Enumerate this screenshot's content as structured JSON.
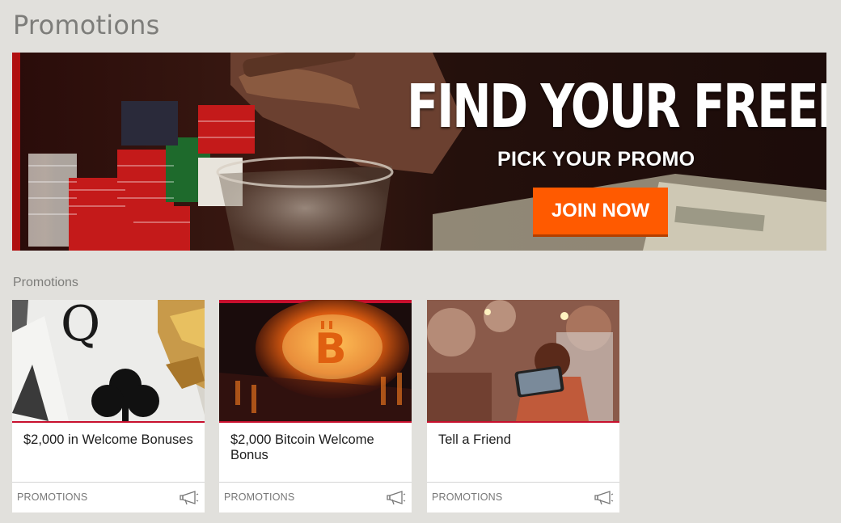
{
  "page": {
    "title": "Promotions"
  },
  "hero": {
    "headline": "FIND YOUR FREEDOM",
    "subheadline": "PICK YOUR PROMO",
    "cta_label": "JOIN NOW",
    "cta_color": "#ff5a00"
  },
  "promotions_section": {
    "label": "Promotions",
    "cards": [
      {
        "title": "$2,000 in Welcome Bonuses",
        "category": "PROMOTIONS",
        "icon": "megaphone-icon"
      },
      {
        "title": "$2,000 Bitcoin Welcome Bonus",
        "category": "PROMOTIONS",
        "icon": "megaphone-icon"
      },
      {
        "title": "Tell a Friend",
        "category": "PROMOTIONS",
        "icon": "megaphone-icon"
      }
    ]
  },
  "colors": {
    "background": "#e1e0dc",
    "accent_red": "#c8102e",
    "card_bg": "#ffffff"
  }
}
